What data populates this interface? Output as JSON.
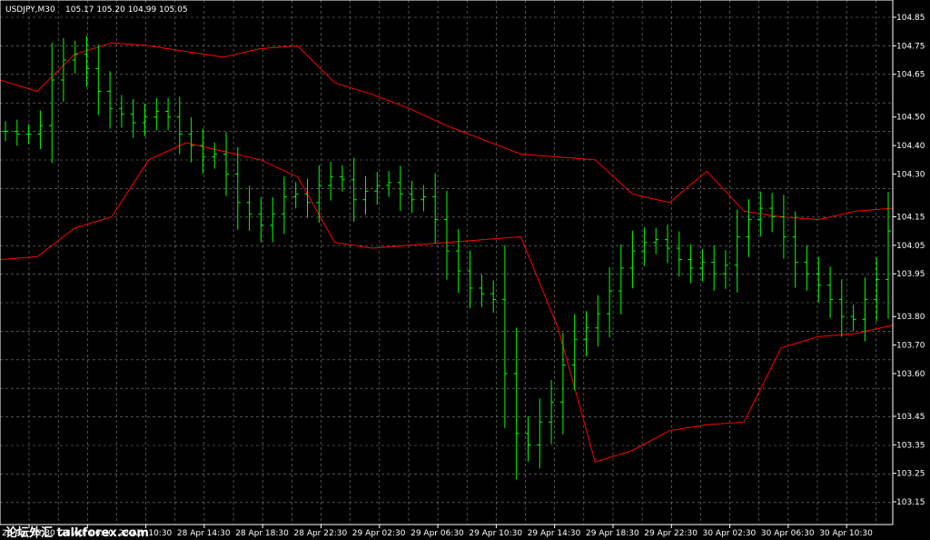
{
  "header": {
    "symbol": "USDJPY,M30",
    "ohlc": "105.17 105.20 104.99 105.05"
  },
  "watermark": {
    "text": "论坛外汇 talkforex.com"
  },
  "colors": {
    "background": "#000000",
    "grid": "#808080",
    "bars": "#00ff00",
    "envelope": "#ff0000",
    "text": "#ffffff"
  },
  "chart_data": {
    "type": "line",
    "title": "",
    "xlabel": "",
    "ylabel": "",
    "ylim": [
      103.1,
      104.9
    ],
    "grid": true,
    "y_ticks": [
      "104.85",
      "104.75",
      "104.65",
      "104.50",
      "104.40",
      "104.30",
      "104.15",
      "104.05",
      "103.95",
      "103.80",
      "103.70",
      "103.60",
      "103.45",
      "103.35",
      "103.25",
      "103.15"
    ],
    "y_tick_values": [
      104.85,
      104.75,
      104.65,
      104.5,
      104.4,
      104.3,
      104.15,
      104.05,
      103.95,
      103.8,
      103.7,
      103.6,
      103.45,
      103.35,
      103.25,
      103.15
    ],
    "x_ticks": [
      "28 Apr 02:30",
      "28 Apr 06:30",
      "28 Apr 10:30",
      "28 Apr 14:30",
      "28 Apr 18:30",
      "28 Apr 22:30",
      "29 Apr 02:30",
      "29 Apr 06:30",
      "29 Apr 10:30",
      "29 Apr 14:30",
      "29 Apr 18:30",
      "29 Apr 22:30",
      "30 Apr 02:30",
      "30 Apr 06:30",
      "30 Apr 10:30"
    ],
    "series": [
      {
        "kind": "envelope",
        "values": [
          104.63,
          104.59,
          104.72,
          104.76,
          104.75,
          104.73,
          104.71,
          104.74,
          104.75,
          104.62,
          104.58,
          104.53,
          104.47,
          104.42,
          104.37,
          104.36,
          104.35,
          104.23,
          104.2,
          104.31,
          104.17,
          104.15,
          104.14,
          104.17,
          104.18
        ]
      },
      {
        "kind": "envelope",
        "values": [
          104.0,
          104.01,
          104.11,
          104.15,
          104.35,
          104.41,
          104.38,
          104.35,
          104.29,
          104.06,
          104.04,
          104.05,
          104.06,
          104.07,
          104.08,
          103.76,
          103.29,
          103.33,
          103.4,
          103.42,
          103.43,
          103.69,
          103.73,
          103.74,
          103.77
        ]
      },
      {
        "kind": "price",
        "values": [
          104.45,
          104.44,
          104.44,
          104.47,
          104.63,
          104.7,
          104.72,
          104.67,
          104.59,
          104.53,
          104.51,
          104.48,
          104.5,
          104.52,
          104.5,
          104.44,
          104.4,
          104.36,
          104.37,
          104.3,
          104.2,
          104.16,
          104.12,
          104.16,
          104.22,
          104.23,
          104.2,
          104.26,
          104.29,
          104.28,
          104.21,
          104.24,
          104.26,
          104.27,
          104.23,
          104.21,
          104.22,
          104.14,
          104.03,
          103.96,
          103.9,
          103.88,
          103.86,
          103.6,
          103.39,
          103.35,
          103.43,
          103.5,
          103.63,
          103.72,
          103.76,
          103.81,
          103.89,
          103.97,
          104.03,
          104.06,
          104.07,
          104.04,
          104.0,
          103.97,
          103.99,
          103.95,
          103.98,
          104.08,
          104.14,
          104.18,
          104.15,
          104.08,
          103.99,
          103.95,
          103.91,
          103.86,
          103.8,
          103.79,
          103.86,
          103.93,
          104.1
        ]
      }
    ]
  }
}
